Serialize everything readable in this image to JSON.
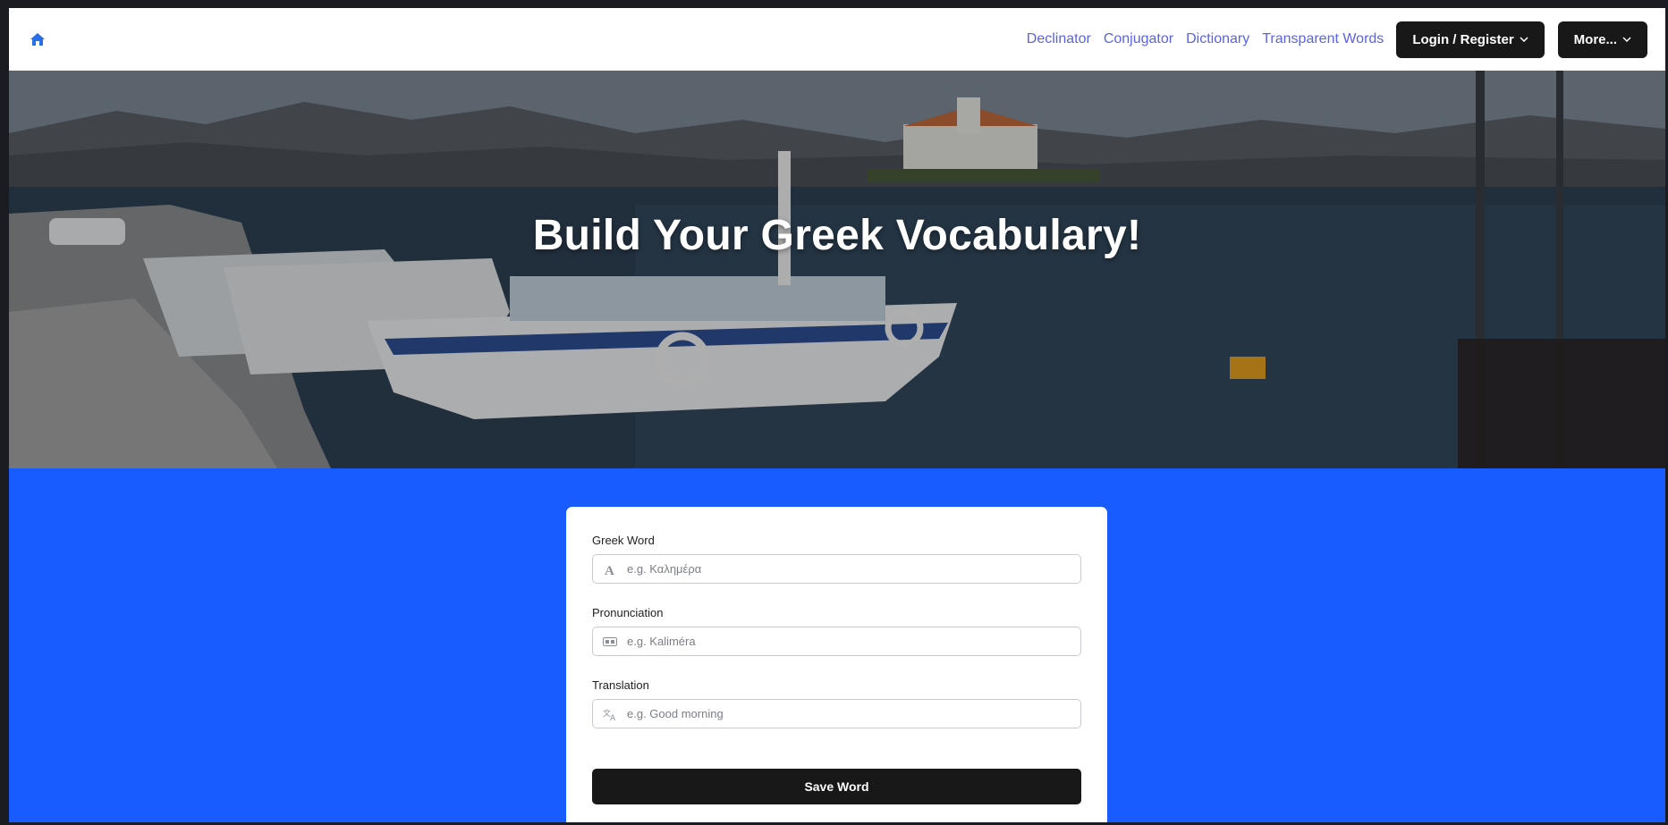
{
  "nav": {
    "links": [
      "Declinator",
      "Conjugator",
      "Dictionary",
      "Transparent Words"
    ],
    "login_label": "Login / Register",
    "more_label": "More...",
    "link_color": "#5a63e6",
    "button_color": "#181818"
  },
  "hero": {
    "title": "Build Your Greek Vocabulary!"
  },
  "form": {
    "greek_word": {
      "label": "Greek Word",
      "placeholder": "e.g. Καλημέρα",
      "icon": "font-icon"
    },
    "pronunciation": {
      "label": "Pronunciation",
      "placeholder": "e.g. Kaliméra",
      "icon": "audio-description-icon"
    },
    "translation": {
      "label": "Translation",
      "placeholder": "e.g. Good morning",
      "icon": "translate-icon"
    },
    "save_label": "Save Word"
  },
  "colors": {
    "accent": "#185bff",
    "card": "#ffffff"
  }
}
